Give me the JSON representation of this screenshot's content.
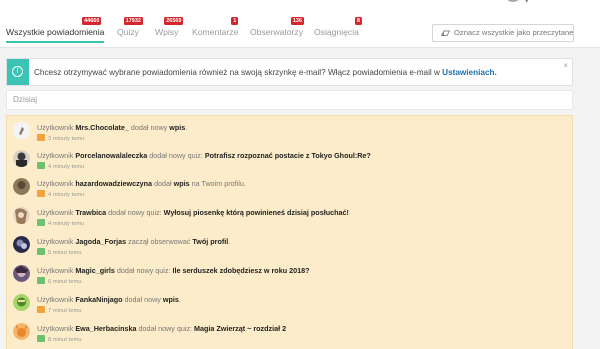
{
  "tabs": [
    {
      "label": "Wszystkie powiadomienia",
      "badge": "44660",
      "active": true
    },
    {
      "label": "Quizy",
      "badge": "17932",
      "active": false
    },
    {
      "label": "Wpisy",
      "badge": "26569",
      "active": false
    },
    {
      "label": "Komentarze",
      "badge": "1",
      "active": false
    },
    {
      "label": "Obserwatorzy",
      "badge": "136",
      "active": false
    },
    {
      "label": "Osiągnięcia",
      "badge": "8",
      "active": false
    }
  ],
  "mark_all_label": "Oznacz wszystkie jako przeczytane",
  "info": {
    "text": "Chcesz otrzymywać wybrane powiadomienia również na swoją skrzynkę e-mail? Włącz powiadomienia e-mail w",
    "link": "Ustawieniach.",
    "close": "×",
    "icon_glyph": "!"
  },
  "day_label": "Dzisiaj",
  "notifications": [
    {
      "prefix": "Użytkownik",
      "user": "Mrs.Chocolate_",
      "action": "dodał nowy",
      "target": "wpis",
      "suffix": ".",
      "time": "3 minuty temu",
      "type": "wpis",
      "avatar_color": "#ffffff"
    },
    {
      "prefix": "Użytkownik",
      "user": "Porcelanowalaleczka",
      "action": "dodał nowy quiz:",
      "target": "Potrafisz rozpoznać postacie z Tokyo Ghoul:Re?",
      "suffix": "",
      "time": "4 minuty temu",
      "type": "quiz",
      "avatar_color": "#3a3a3a"
    },
    {
      "prefix": "Użytkownik",
      "user": "hazardowadziewczyna",
      "action": "dodał",
      "target": "wpis",
      "suffix": " na Twoim profilu.",
      "time": "4 minuty temu",
      "type": "wpis",
      "avatar_color": "#7a6a4a"
    },
    {
      "prefix": "Użytkownik",
      "user": "Trawbica",
      "action": "dodał nowy quiz:",
      "target": "Wyłosuj piosenkę którą powinieneś dzisiaj posłuchać!",
      "suffix": "",
      "time": "4 minuty temu",
      "type": "quiz",
      "avatar_color": "#c2a48a"
    },
    {
      "prefix": "Użytkownik",
      "user": "Jagoda_Forjas",
      "action": "zaczął obserwować",
      "target": "Twój profil",
      "suffix": ".",
      "time": "5 minut temu",
      "type": "follow",
      "avatar_color": "#5a5a8a"
    },
    {
      "prefix": "Użytkownik",
      "user": "Magic_girls",
      "action": "dodał nowy quiz:",
      "target": "Ile serduszek zdobędziesz w roku 2018?",
      "suffix": "",
      "time": "6 minut temu",
      "type": "quiz",
      "avatar_color": "#6a4a6a"
    },
    {
      "prefix": "Użytkownik",
      "user": "FankaNinjago",
      "action": "dodał nowy",
      "target": "wpis",
      "suffix": ".",
      "time": "7 minut temu",
      "type": "wpis",
      "avatar_color": "#6a9a3a"
    },
    {
      "prefix": "Użytkownik",
      "user": "Ewa_Herbacinska",
      "action": "dodał nowy quiz:",
      "target": "Magia Zwierząt ~ rozdział 2",
      "suffix": "",
      "time": "8 minut temu",
      "type": "quiz",
      "avatar_color": "#e08a3a"
    }
  ]
}
